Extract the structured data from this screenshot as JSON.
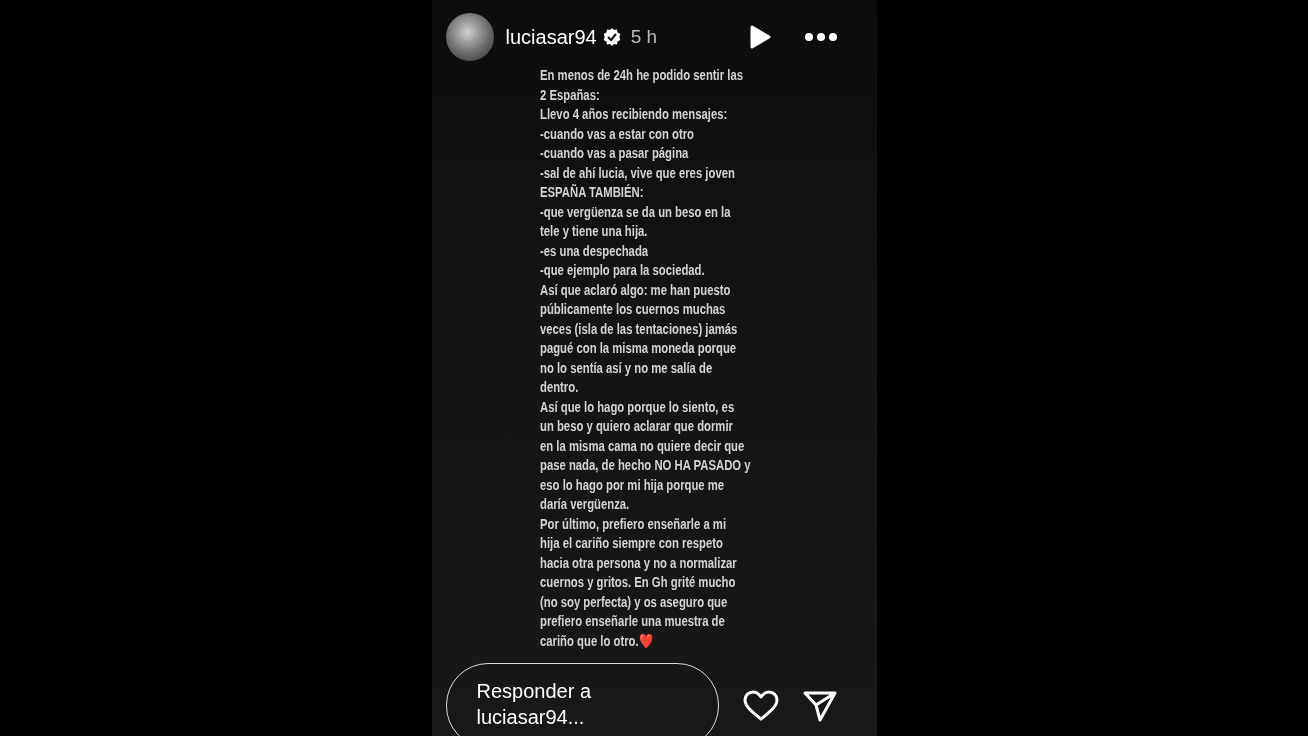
{
  "story": {
    "username": "luciasar94",
    "verified": true,
    "time": "5 h",
    "text_lines": [
      "En menos de 24h he podido sentir las",
      "2 Españas:",
      "Llevo 4 años recibiendo mensajes:",
      "-cuando vas a estar con otro",
      "-cuando vas a pasar página",
      "-sal de ahí lucia, vive que eres joven",
      "ESPAÑA TAMBIÉN:",
      "-que vergüenza se da un beso en la",
      "tele y tiene una hija.",
      "-es una despechada",
      "-que ejemplo para la sociedad.",
      "Así que aclaró algo: me han puesto",
      "públicamente los cuernos muchas",
      "veces (isla de las tentaciones) jamás",
      "pagué con la misma moneda porque",
      "no lo sentía así y no me salía de",
      "dentro.",
      "Así que lo hago porque lo siento, es",
      "un beso y quiero aclarar que dormir",
      "en la misma cama no quiere decir que",
      "pase nada, de hecho NO HA PASADO y",
      "eso lo hago por mi hija porque me",
      "daría vergüenza.",
      "Por último, prefiero enseñarle a mi",
      "hija el cariño siempre con respeto",
      "hacia otra persona y no a normalizar",
      "cuernos y gritos. En Gh grité mucho",
      "(no soy perfecta) y os aseguro que",
      "prefiero enseñarle una muestra de",
      "cariño que lo otro.❤️"
    ]
  },
  "reply": {
    "placeholder": "Responder a luciasar94..."
  }
}
